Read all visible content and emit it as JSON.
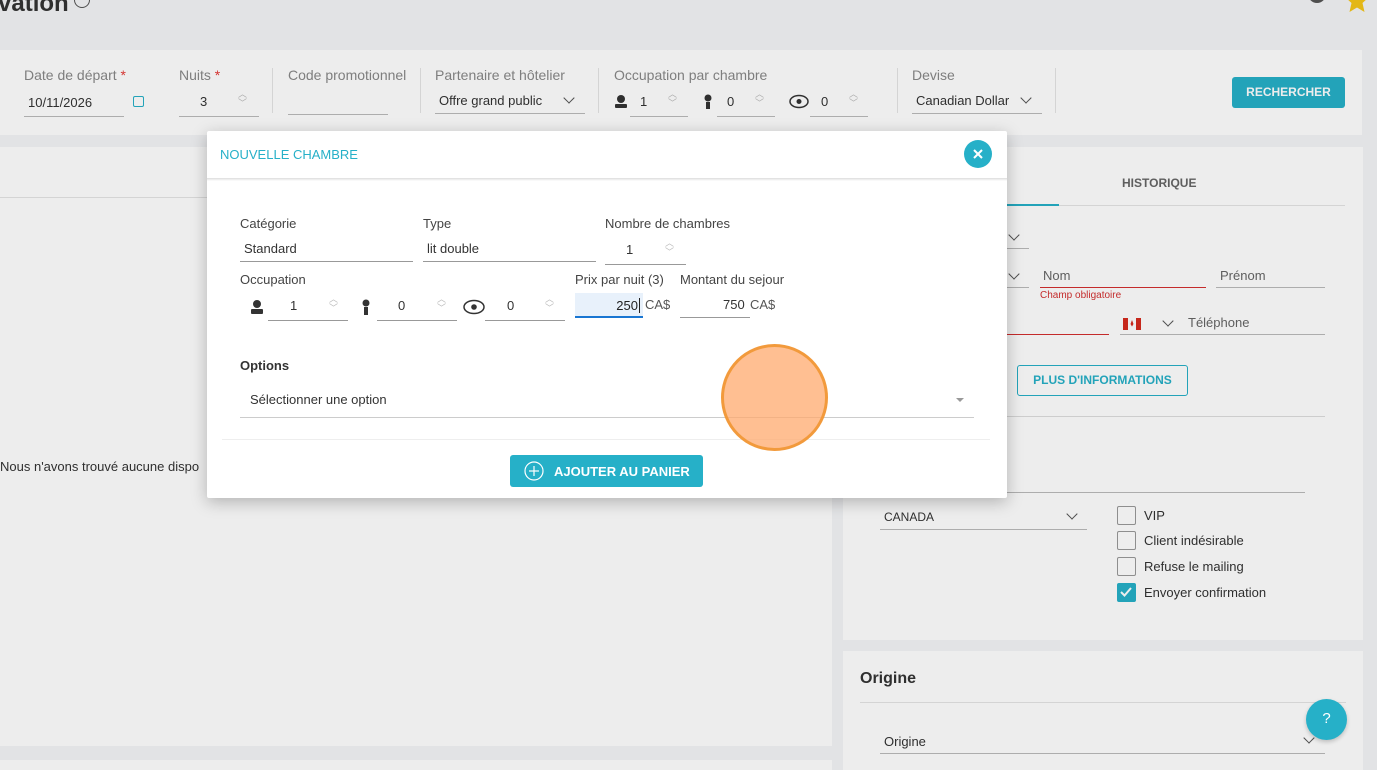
{
  "header": {
    "title": "vation"
  },
  "search_bar": {
    "departure_label": "Date de départ",
    "departure_value": "10/11/2026",
    "nights_label": "Nuits",
    "nights_value": "3",
    "required_mark": "*",
    "promo_label": "Code promotionnel",
    "promo_value": "",
    "partner_label": "Partenaire et hôtelier",
    "partner_value": "Offre grand public",
    "occupancy_label": "Occupation par chambre",
    "adults": "1",
    "children": "0",
    "infants": "0",
    "currency_label": "Devise",
    "currency_value": "Canadian Dollar",
    "search_button": "RECHERCHER"
  },
  "left_panel": {
    "message": "Nous n'avons trouvé aucune dispo"
  },
  "right_panel": {
    "tab_history": "HISTORIQUE",
    "nom_placeholder": "Nom",
    "prenom_placeholder": "Prénom",
    "required_error": "Champ obligatoire",
    "phone_placeholder": "Téléphone",
    "more_info_button": "PLUS D'INFORMATIONS",
    "country_value": "CANADA",
    "checkboxes": [
      {
        "label": "VIP",
        "checked": false
      },
      {
        "label": "Client indésirable",
        "checked": false
      },
      {
        "label": "Refuse le mailing",
        "checked": false
      },
      {
        "label": "Envoyer confirmation",
        "checked": true
      }
    ],
    "origin_title": "Origine",
    "origin_select": "Origine"
  },
  "modal": {
    "title": "NOUVELLE CHAMBRE",
    "category_label": "Catégorie",
    "category_value": "Standard",
    "type_label": "Type",
    "type_value": "lit double",
    "rooms_label": "Nombre de chambres",
    "rooms_value": "1",
    "occupation_label": "Occupation",
    "adults": "1",
    "children": "0",
    "infants": "0",
    "price_label": "Prix par nuit (3)",
    "price_value": "250",
    "price_currency": "CA$",
    "total_label": "Montant du sejour",
    "total_value": "750",
    "total_currency": "CA$",
    "options_label": "Options",
    "options_placeholder": "Sélectionner une option",
    "add_button": "AJOUTER AU PANIER"
  },
  "help_button": "?",
  "colors": {
    "accent": "#26b0c8",
    "error": "#d32f2f",
    "cursor_highlight": "#f7a65c"
  }
}
